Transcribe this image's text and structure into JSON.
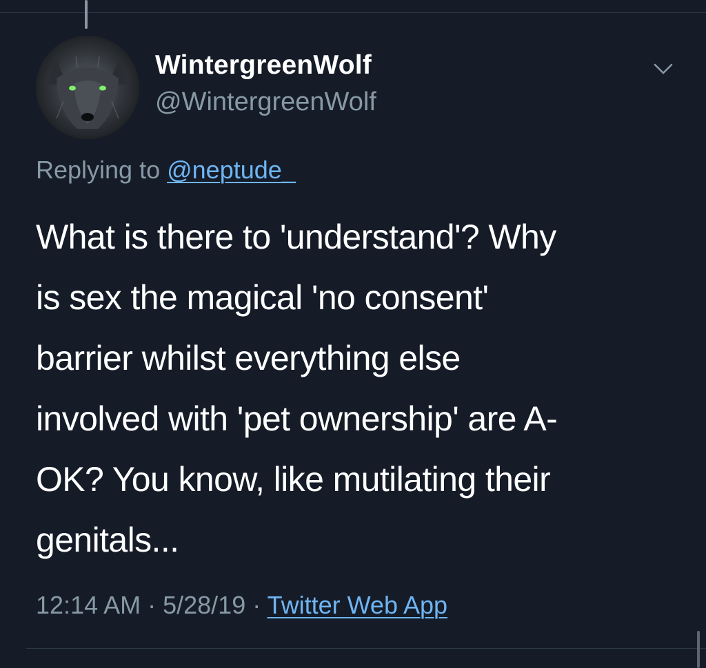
{
  "author": {
    "display_name": "WintergreenWolf",
    "handle": "@WintergreenWolf",
    "avatar_icon": "wolf-avatar"
  },
  "reply": {
    "prefix": "Replying to ",
    "mention": "@neptude_"
  },
  "tweet": {
    "text": "What is there to 'understand'? Why\nis sex the magical 'no consent'\nbarrier whilst everything else\ninvolved with 'pet ownership' are A-\nOK? You know, like mutilating their\ngenitals..."
  },
  "meta": {
    "time": "12:14 AM",
    "separator1": " · ",
    "date": "5/28/19",
    "separator2": " · ",
    "source": "Twitter Web App"
  },
  "colors": {
    "background": "#151c28",
    "secondary_text": "#8899a6",
    "link": "#6fb5f3",
    "primary_text": "#ffffff"
  },
  "icons": {
    "more": "chevron-down-icon"
  }
}
